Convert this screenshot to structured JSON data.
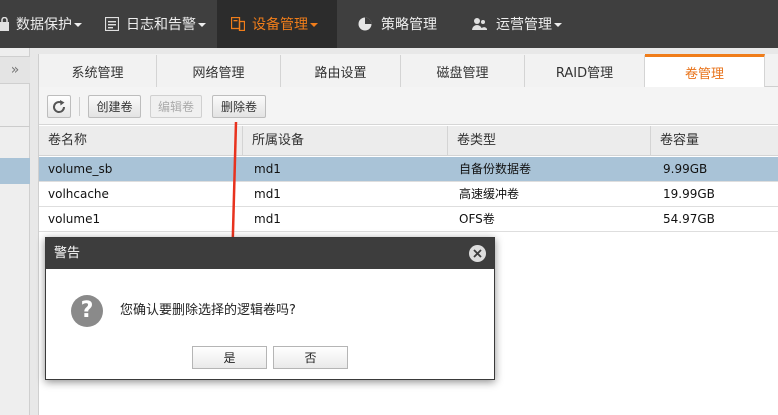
{
  "topnav": {
    "items": [
      {
        "label": "数据保护",
        "icon": "lock-icon",
        "has_caret": true
      },
      {
        "label": "日志和告警",
        "icon": "log-icon",
        "has_caret": true
      },
      {
        "label": "设备管理",
        "icon": "device-icon",
        "has_caret": true,
        "active": true
      },
      {
        "label": "策略管理",
        "icon": "pie-chart-icon",
        "has_caret": false
      },
      {
        "label": "运营管理",
        "icon": "users-icon",
        "has_caret": true
      }
    ],
    "colors": {
      "background": "#3f3f3f",
      "active_background": "#2c2c2c",
      "active_text": "#f07d1a"
    }
  },
  "left_panel": {
    "collapse_label": "»"
  },
  "tabs": [
    {
      "label": "系统管理"
    },
    {
      "label": "网络管理"
    },
    {
      "label": "路由设置"
    },
    {
      "label": "磁盘管理"
    },
    {
      "label": "RAID管理"
    },
    {
      "label": "卷管理",
      "active": true
    }
  ],
  "toolbar": {
    "refresh_icon": "refresh-icon",
    "create_label": "创建卷",
    "edit_label": "编辑卷",
    "delete_label": "删除卷"
  },
  "table": {
    "columns": [
      "卷名称",
      "所属设备",
      "卷类型",
      "卷容量"
    ],
    "rows": [
      {
        "name": "volume_sb",
        "device": "md1",
        "type": "自备份数据卷",
        "size": "9.99GB",
        "selected": true
      },
      {
        "name": "volhcache",
        "device": "md1",
        "type": "高速缓冲卷",
        "size": "19.99GB"
      },
      {
        "name": "volume1",
        "device": "md1",
        "type": "OFS卷",
        "size": "54.97GB"
      }
    ]
  },
  "annotation": {
    "arrow_color": "#e8321e"
  },
  "dialog": {
    "title": "警告",
    "icon": "question-icon",
    "icon_glyph": "?",
    "message": "您确认要删除选择的逻辑卷吗?",
    "ok_label": "是",
    "cancel_label": "否"
  },
  "colors": {
    "accent": "#f07d1a",
    "selected_row": "#a9c3d7"
  }
}
